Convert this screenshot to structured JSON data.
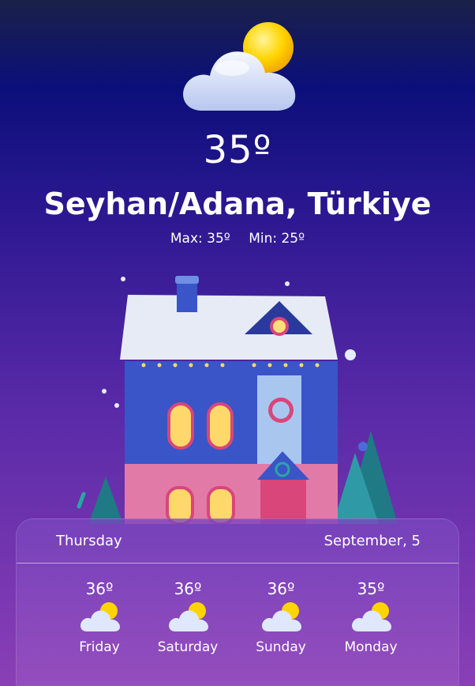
{
  "current": {
    "icon": "partly-cloudy-icon",
    "temperature": "35º",
    "location": "Seyhan/Adana, Türkiye",
    "max_label": "Max: 35º",
    "min_label": "Min: 25º"
  },
  "panel": {
    "day": "Thursday",
    "date": "September, 5"
  },
  "forecast": [
    {
      "temp": "36º",
      "day": "Friday",
      "icon": "partly-cloudy-icon"
    },
    {
      "temp": "36º",
      "day": "Saturday",
      "icon": "partly-cloudy-icon"
    },
    {
      "temp": "36º",
      "day": "Sunday",
      "icon": "partly-cloudy-icon"
    },
    {
      "temp": "35º",
      "day": "Monday",
      "icon": "partly-cloudy-icon"
    }
  ],
  "colors": {
    "bg_top": "#0b0f7a",
    "bg_bottom": "#8a3fb6",
    "sun": "#ffd400",
    "cloud": "#dfe8ff"
  }
}
